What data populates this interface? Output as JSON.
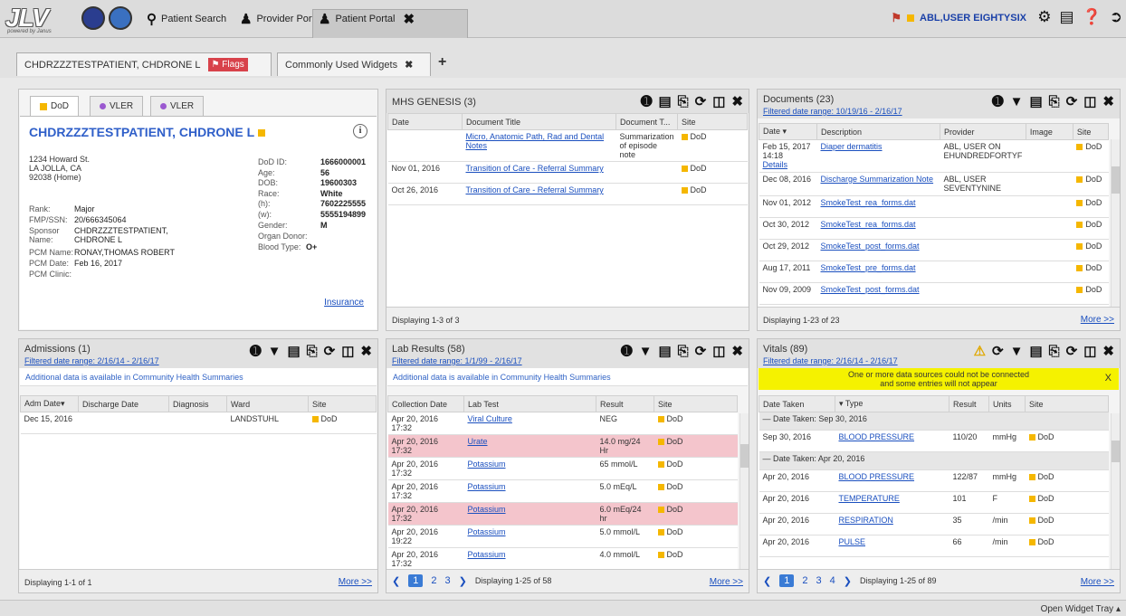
{
  "app": {
    "logo": "JLV",
    "logo_sub": "powered by Janus",
    "user": "ABL,USER EIGHTYSIX"
  },
  "nav": {
    "patient_search": "Patient Search",
    "provider_portal": "Provider Portal",
    "patient_portal": "Patient Portal"
  },
  "tabs": {
    "patient": "CHDRZZZTESTPATIENT, CHDRONE L",
    "flags": "Flags",
    "widgets": "Commonly Used Widgets"
  },
  "demo": {
    "tabs": [
      "DoD",
      "VLER",
      "VLER"
    ],
    "name": "CHDRZZZTESTPATIENT, CHDRONE L",
    "address": [
      "1234 Howard St.",
      "LA JOLLA, CA",
      "92038 (Home)"
    ],
    "left": [
      [
        "Rank:",
        "Major"
      ],
      [
        "FMP/SSN:",
        "20/666345064"
      ],
      [
        "Sponsor Name:",
        "CHDRZZZTESTPATIENT, CHDRONE L"
      ],
      [
        "PCM Name:",
        "RONAY,THOMAS ROBERT"
      ],
      [
        "PCM Date:",
        "Feb 16, 2017"
      ],
      [
        "PCM Clinic:",
        ""
      ]
    ],
    "right": [
      [
        "DoD ID:",
        "1666000001"
      ],
      [
        "Age:",
        "56"
      ],
      [
        "DOB:",
        "19600303"
      ],
      [
        "Race:",
        "White"
      ],
      [
        "(h):",
        "7602225555"
      ],
      [
        "(w):",
        "5555194899"
      ],
      [
        "Gender:",
        "M"
      ],
      [
        "Organ Donor:",
        ""
      ],
      [
        "Blood Type:",
        "O+"
      ]
    ],
    "insurance": "Insurance"
  },
  "mhs": {
    "title": "MHS GENESIS (3)",
    "cols": [
      "Date",
      "Document Title",
      "Document T...",
      "Site"
    ],
    "rows": [
      [
        "",
        "Micro, Anatomic Path, Rad and Dental Notes",
        "Summarization of episode note",
        "DoD"
      ],
      [
        "Nov 01, 2016",
        "Transition of Care - Referral Summary",
        "",
        "DoD"
      ],
      [
        "Oct 26, 2016",
        "Transition of Care - Referral Summary",
        "",
        "DoD"
      ]
    ],
    "footer": "Displaying 1-3 of 3"
  },
  "docs": {
    "title": "Documents (23)",
    "filter": "Filtered date range: 10/19/16 - 2/16/17",
    "cols": [
      "Date",
      "Description",
      "Provider",
      "Image",
      "Site"
    ],
    "rows": [
      [
        "Feb 15, 2017 14:18",
        "Diaper dermatitis",
        "ABL, USER ON EHUNDREDFORTYF",
        "",
        "DoD"
      ],
      [
        "Dec 08, 2016",
        "Discharge Summarization Note",
        "ABL, USER SEVENTYNINE",
        "",
        "DoD"
      ],
      [
        "Nov 01, 2012",
        "SmokeTest_rea_forms.dat",
        "",
        "",
        "DoD"
      ],
      [
        "Oct 30, 2012",
        "SmokeTest_rea_forms.dat",
        "",
        "",
        "DoD"
      ],
      [
        "Oct 29, 2012",
        "SmokeTest_post_forms.dat",
        "",
        "",
        "DoD"
      ],
      [
        "Aug 17, 2011",
        "SmokeTest_pre_forms.dat",
        "",
        "",
        "DoD"
      ],
      [
        "Nov 09, 2009",
        "SmokeTest_post_forms.dat",
        "",
        "",
        "DoD"
      ]
    ],
    "details": "Details",
    "footer": "Displaying 1-23 of 23",
    "more": "More >>"
  },
  "adm": {
    "title": "Admissions (1)",
    "filter": "Filtered date range: 2/16/14 - 2/16/17",
    "notice": "Additional data is available in Community Health Summaries",
    "cols": [
      "Adm Date",
      "Discharge Date",
      "Diagnosis",
      "Ward",
      "Site"
    ],
    "rows": [
      [
        "Dec 15, 2016",
        "",
        "",
        "LANDSTUHL",
        "DoD"
      ]
    ],
    "footer": "Displaying 1-1 of 1",
    "more": "More >>"
  },
  "lab": {
    "title": "Lab Results (58)",
    "filter": "Filtered date range: 1/1/99 - 2/16/17",
    "notice": "Additional data is available in Community Health Summaries",
    "cols": [
      "Collection Date",
      "Lab Test",
      "Result",
      "Site"
    ],
    "rows": [
      [
        "Apr 20, 2016 17:32",
        "Viral Culture",
        "NEG",
        "DoD",
        false
      ],
      [
        "Apr 20, 2016 17:32",
        "Urate",
        "14.0 mg/24 Hr",
        "DoD",
        true
      ],
      [
        "Apr 20, 2016 17:32",
        "Potassium",
        "65 mmol/L",
        "DoD",
        false
      ],
      [
        "Apr 20, 2016 17:32",
        "Potassium",
        "5.0 mEq/L",
        "DoD",
        false
      ],
      [
        "Apr 20, 2016 17:32",
        "Potassium",
        "6.0 mEq/24 hr",
        "DoD",
        true
      ],
      [
        "Apr 20, 2016 19:22",
        "Potassium",
        "5.0 mmol/L",
        "DoD",
        false
      ],
      [
        "Apr 20, 2016 17:32",
        "Potassium",
        "4.0 mmol/L",
        "DoD",
        false
      ]
    ],
    "pages": [
      "1",
      "2",
      "3"
    ],
    "footer": "Displaying 1-25 of 58",
    "more": "More >>"
  },
  "vit": {
    "title": "Vitals (89)",
    "filter": "Filtered date range: 2/16/14 - 2/16/17",
    "warn1": "One or more data sources could not be connected",
    "warn2": "and some entries will not appear",
    "warn_close": "X",
    "cols": [
      "Date Taken",
      "Type",
      "Result",
      "Units",
      "Site"
    ],
    "groups": [
      {
        "label": "Date Taken:  Sep 30, 2016",
        "rows": [
          [
            "Sep 30, 2016",
            "BLOOD PRESSURE",
            "110/20",
            "mmHg",
            "DoD"
          ]
        ]
      },
      {
        "label": "Date Taken:  Apr 20, 2016",
        "rows": [
          [
            "Apr 20, 2016",
            "BLOOD PRESSURE",
            "122/87",
            "mmHg",
            "DoD"
          ],
          [
            "Apr 20, 2016",
            "TEMPERATURE",
            "101",
            "F",
            "DoD"
          ],
          [
            "Apr 20, 2016",
            "RESPIRATION",
            "35",
            "/min",
            "DoD"
          ],
          [
            "Apr 20, 2016",
            "PULSE",
            "66",
            "/min",
            "DoD"
          ]
        ]
      }
    ],
    "pages": [
      "1",
      "2",
      "3",
      "4"
    ],
    "footer": "Displaying 1-25 of 89",
    "more": "More >>"
  },
  "bottom": {
    "tray": "Open Widget Tray"
  },
  "icons": [
    "search-icon",
    "user-icon",
    "close-icon",
    "gear-icon",
    "list-icon",
    "help-icon",
    "logout-icon",
    "info-icon",
    "filter-icon",
    "clipboard-icon",
    "print-icon",
    "refresh-icon",
    "columns-icon",
    "warning-icon"
  ]
}
